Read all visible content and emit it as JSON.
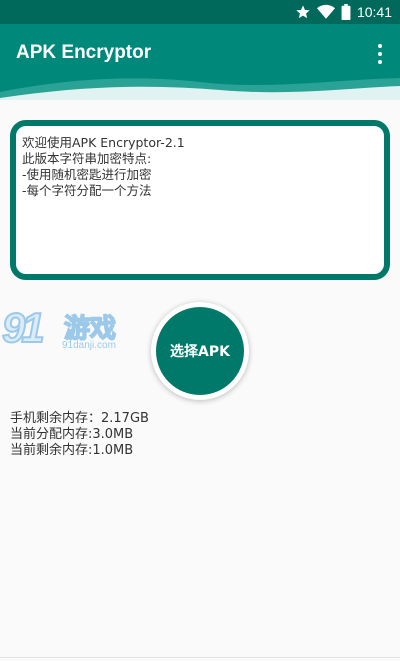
{
  "status_bar": {
    "time": "10:41",
    "icons": [
      "star-icon",
      "wifi-icon",
      "battery-icon"
    ]
  },
  "app_bar": {
    "title": "APK Encryptor",
    "menu_icon": "more-vert-icon"
  },
  "text_area": {
    "lines": [
      "欢迎使用APK Encryptor-2.1",
      "此版本字符串加密特点:",
      "-使用随机密匙进行加密",
      "-每个字符分配一个方法"
    ]
  },
  "watermark": {
    "number": "91",
    "name": "游戏",
    "url": "91danji.com"
  },
  "select_button": {
    "label": "选择APK"
  },
  "memory_info": {
    "lines": [
      "手机剩余内存：2.17GB",
      "当前分配内存:3.0MB",
      "当前剩余内存:1.0MB"
    ]
  },
  "colors": {
    "status_bar": "#00695c",
    "app_bar": "#00897b",
    "accent": "#00796b",
    "background": "#fafafa"
  }
}
